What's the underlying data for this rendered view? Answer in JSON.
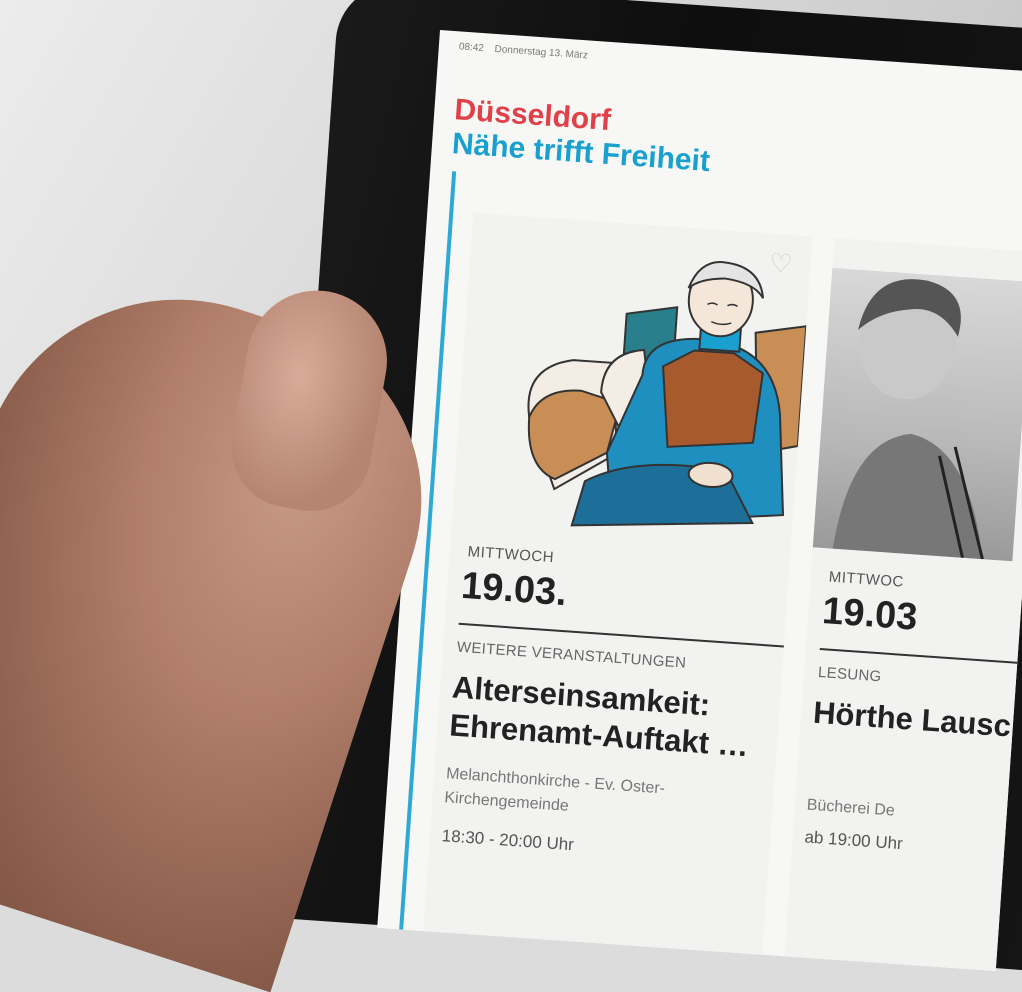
{
  "status_bar": {
    "time": "08:42",
    "date": "Donnerstag 13. März"
  },
  "brand": {
    "line1": "Düsseldorf",
    "line2": "Nähe trifft Freiheit"
  },
  "colors": {
    "brand_red": "#e04048",
    "brand_blue": "#1aa0cf"
  },
  "events": [
    {
      "weekday": "MITTWOCH",
      "date": "19.03.",
      "category": "WEITERE VERANSTALTUNGEN",
      "title": "Alterseinsamkeit: Ehrenamt-Auftakt …",
      "location": "Melanchthonkirche - Ev. Oster-Kirchengemeinde",
      "time": "18:30 - 20:00 Uhr",
      "favorite_icon": "heart-icon"
    },
    {
      "weekday": "MITTWOC",
      "date": "19.03",
      "category": "LESUNG",
      "title": "Hörthe Lausch",
      "location": "Bücherei De",
      "time": "ab 19:00 Uhr"
    }
  ]
}
